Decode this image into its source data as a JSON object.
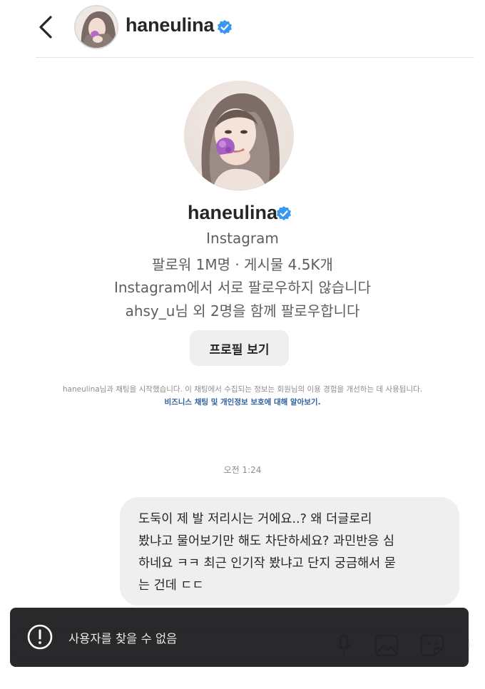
{
  "header": {
    "username": "haneulina"
  },
  "profile": {
    "username": "haneulina",
    "platform": "Instagram",
    "stats": "팔로워 1M명 · 게시물 4.5K개",
    "follow_status": "Instagram에서 서로 팔로우하지 않습니다",
    "mutual": "ahsy_u님 외 2명을 함께 팔로우합니다",
    "view_profile_label": "프로필 보기"
  },
  "notice": {
    "text": "haneulina님과 채팅을 시작했습니다. 이 채팅에서 수집되는 정보는 회원님의 이용 경험을 개선하는 데 사용됩니다.",
    "link": "비즈니스 채팅 및 개인정보 보호에 대해 알아보기."
  },
  "chat": {
    "timestamp": "오전 1:24",
    "messages": [
      {
        "lines": [
          "도둑이 제 발 저리시는 거에요..? 왜 더글로리",
          "봤냐고 물어보기만 해도 차단하세요? 과민반응 심",
          "하네요 ㅋㅋ 최근 인기작 봤냐고 단지 궁금해서 묻",
          "는 건데 ㄷㄷ"
        ]
      }
    ]
  },
  "composer": {
    "icons": [
      "microphone-icon",
      "gallery-icon",
      "sticker-icon"
    ]
  },
  "toast": {
    "icon": "alert-circle-icon",
    "text": "사용자를 찾을 수 없음"
  },
  "colors": {
    "verified_blue": "#3897f0",
    "link_blue": "#2b5f9e",
    "bubble_gray": "#efefef",
    "toast_bg": "#1c1c1e"
  }
}
